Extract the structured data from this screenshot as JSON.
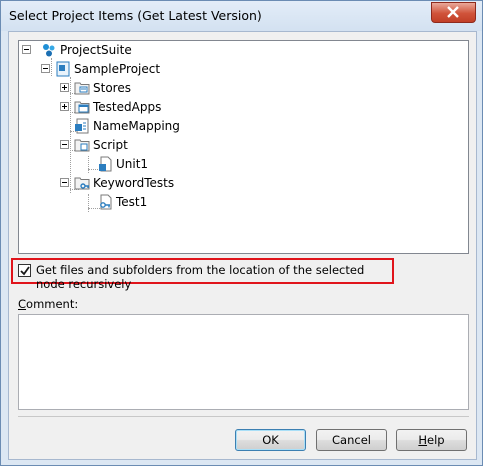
{
  "window": {
    "title": "Select Project Items (Get Latest Version)"
  },
  "tree": {
    "nodes": [
      {
        "label": "ProjectSuite",
        "icon": "project-suite-icon",
        "expander": "minus"
      },
      {
        "label": "SampleProject",
        "icon": "project-icon",
        "expander": "minus"
      },
      {
        "label": "Stores",
        "icon": "stores-icon",
        "expander": "plus"
      },
      {
        "label": "TestedApps",
        "icon": "tested-apps-icon",
        "expander": "plus"
      },
      {
        "label": "NameMapping",
        "icon": "name-mapping-icon",
        "expander": "none"
      },
      {
        "label": "Script",
        "icon": "script-folder-icon",
        "expander": "minus"
      },
      {
        "label": "Unit1",
        "icon": "unit-file-icon",
        "expander": "none"
      },
      {
        "label": "KeywordTests",
        "icon": "keyword-tests-folder-icon",
        "expander": "minus"
      },
      {
        "label": "Test1",
        "icon": "keyword-test-file-icon",
        "expander": "none"
      }
    ]
  },
  "options": {
    "recursive_label": "Get files and subfolders from the location of the selected node recursively",
    "recursive_checked": true
  },
  "comment": {
    "label_first": "C",
    "label_rest": "omment:",
    "value": ""
  },
  "buttons": {
    "ok": "OK",
    "cancel": "Cancel",
    "help_first": "H",
    "help_rest": "elp"
  },
  "colors": {
    "highlight_border": "#e0141b",
    "close_button": "#c7432a"
  }
}
